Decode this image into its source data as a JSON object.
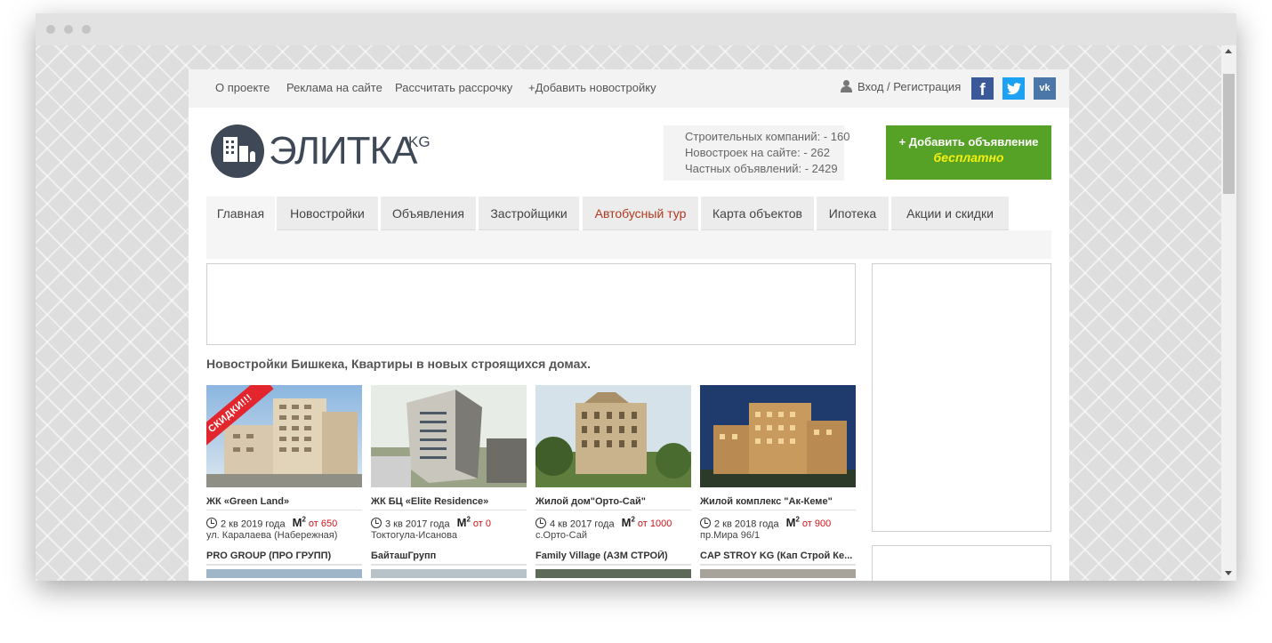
{
  "topnav": {
    "links": [
      "О проекте",
      "Реклама на сайте",
      "Рассчитать рассрочку",
      "+Добавить новостройку"
    ],
    "login": "Вход / Регистрация"
  },
  "social": {
    "facebook": "f",
    "twitter": "t",
    "vk": "vk"
  },
  "logo": {
    "text": "ЭЛИТКА",
    "suffix": "KG"
  },
  "stats": {
    "companies": "Строительных компаний: - 160",
    "newbuildings": "Новостроек на сайте: - 262",
    "private_ads": "Частных объявлений: - 2429"
  },
  "add_button": {
    "line1": "+ Добавить объявление",
    "line2": "бесплатно"
  },
  "tabs": [
    "Главная",
    "Новостройки",
    "Объявления",
    "Застройщики",
    "Автобусный тур",
    "Карта объектов",
    "Ипотека",
    "Акции и скидки"
  ],
  "heading": "Новостройки Бишкека, Квартиры в новых строящихся домах.",
  "sale_badge": "СКИДКИ!!!",
  "listings": [
    {
      "name": "ЖК «Green Land»",
      "date": "2 кв 2019 года",
      "price": "от 650",
      "address": "ул. Каралаева (Набережная)",
      "company": "PRO GROUP (ПРО ГРУПП)"
    },
    {
      "name": "ЖК БЦ «Elite Residence»",
      "date": "3 кв 2017 года",
      "price": "от 0",
      "address": "Токтогула-Исанова",
      "company": "БайташГрупп"
    },
    {
      "name": "Жилой дом\"Орто-Сай\"",
      "date": "4 кв 2017 года",
      "price": "от 1000",
      "address": "с.Орто-Сай",
      "company": "Family Village (АЗМ СТРОЙ)"
    },
    {
      "name": "Жилой комплекс \"Ак-Кеме\"",
      "date": "2 кв 2018 года",
      "price": "от 900",
      "address": "пр.Мира 96/1",
      "company": "CAP STROY KG (Кап Строй Ке..."
    }
  ],
  "m2_label": "М",
  "colors": {
    "accent_green": "#56a226",
    "price_red": "#d0131b",
    "logo_dark": "#3f4856",
    "bus_tour": "#b03a1e"
  }
}
